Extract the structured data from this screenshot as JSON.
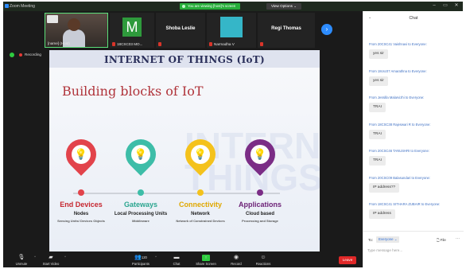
{
  "window": {
    "title": "Zoom Meeting",
    "viewing_banner": "You are viewing [host]'s screen",
    "view_options": "View Options ⌄",
    "minimize": "–",
    "maximize": "▭",
    "close": "✕"
  },
  "participants": {
    "thumbs": [
      {
        "name": "[name] (Host)"
      },
      {
        "letter": "M",
        "name": "18CSC03 MO..."
      },
      {
        "name": "Shoba Leslie"
      },
      {
        "name": "Narmadha V"
      },
      {
        "name": "Regi Thomas"
      }
    ],
    "next": "›",
    "view_label": "View"
  },
  "recording": {
    "label": "Recording"
  },
  "slide": {
    "header": "INTERNET OF THINGS (IoT)",
    "subtitle": "Building blocks of IoT",
    "watermark": "INTERNET THINGS",
    "blocks": [
      {
        "title": "End Devices",
        "sub": "Nodes",
        "desc": "Sensing Units/ Devices Objects",
        "color": "#e2434b",
        "title_color": "#c6262f",
        "icon": "💡"
      },
      {
        "title": "Gateways",
        "sub": "Local Processing Units",
        "desc": "Middleware",
        "color": "#3dbda8",
        "title_color": "#2aa58f",
        "icon": "💡"
      },
      {
        "title": "Connectivity",
        "sub": "Network",
        "desc": "Network of Constrained Devices",
        "color": "#f4c21c",
        "title_color": "#e0a800",
        "icon": "💡"
      },
      {
        "title": "Applications",
        "sub": "Cloud based",
        "desc": "Processing and Storage",
        "color": "#7b2d86",
        "title_color": "#6d2277",
        "icon": "💡"
      }
    ]
  },
  "toolbar": {
    "unmute": "Unmute",
    "start_video": "Start Video",
    "participants": "Participants",
    "participants_count": "120",
    "chat": "Chat",
    "share_screen": "Share Screen",
    "record": "Record",
    "reactions": "Reactions",
    "leave": "Leave"
  },
  "chat": {
    "title": "Chat",
    "messages": [
      {
        "from": "From 20CSC41 Vaishnavi to Everyone:",
        "text": "yes sir"
      },
      {
        "from": "From 18csc07 Amarathna to Everyone:",
        "text": "yes sir"
      },
      {
        "from": "From Jessilla Malarvizhi to Everyone:",
        "text": "TRAI"
      },
      {
        "from": "From 18CSC38 Rajeswari R to Everyone:",
        "text": "TRAI"
      },
      {
        "from": "From 20CSC46 TANUSHRI to Everyone:",
        "text": "TRAI"
      },
      {
        "from": "From 20CSC09 Balasundari to Everyone:",
        "text": "IP address??"
      },
      {
        "from": "From 18CSC41 SITHARA ZUBAIR to Everyone:",
        "text": "IP address"
      }
    ],
    "to_label": "To:",
    "to_value": "Everyone ⌄",
    "file_label": "File",
    "more": "···",
    "input_placeholder": "Type message here..."
  },
  "colors": {
    "green_banner": "#27ae3a",
    "leave_red": "#e02828",
    "accent_blue": "#2d8cff"
  }
}
